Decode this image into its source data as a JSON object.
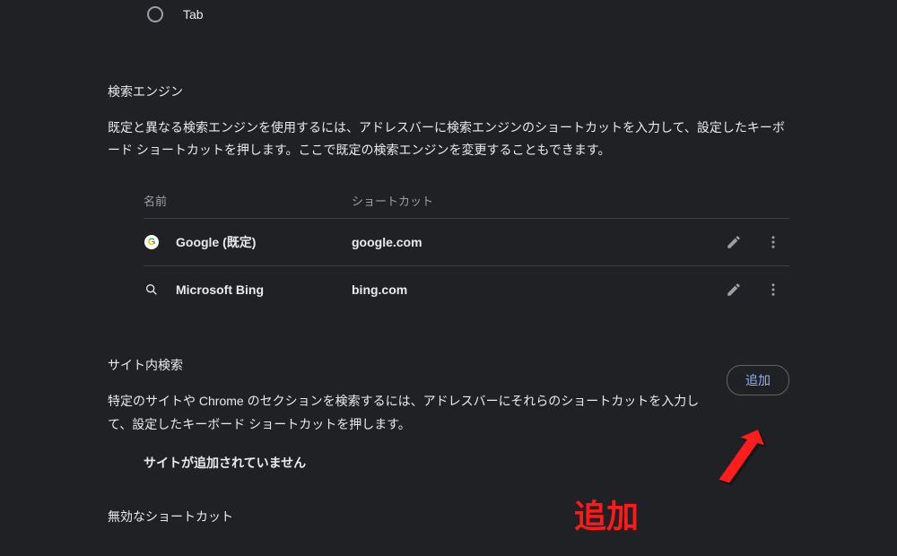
{
  "radio": {
    "tab_label": "Tab"
  },
  "search_engines": {
    "title": "検索エンジン",
    "description": "既定と異なる検索エンジンを使用するには、アドレスバーに検索エンジンのショートカットを入力して、設定したキーボード ショートカットを押します。ここで既定の検索エンジンを変更することもできます。",
    "col_name": "名前",
    "col_shortcut": "ショートカット",
    "rows": [
      {
        "name": "Google (既定)",
        "shortcut": "google.com",
        "icon": "google"
      },
      {
        "name": "Microsoft Bing",
        "shortcut": "bing.com",
        "icon": "search"
      }
    ]
  },
  "site_search": {
    "title": "サイト内検索",
    "description": "特定のサイトや Chrome のセクションを検索するには、アドレスバーにそれらのショートカットを入力して、設定したキーボード ショートカットを押します。",
    "add_label": "追加",
    "empty": "サイトが追加されていません"
  },
  "disabled_shortcuts": {
    "title": "無効なショートカット"
  },
  "annotation": {
    "text": "追加"
  }
}
